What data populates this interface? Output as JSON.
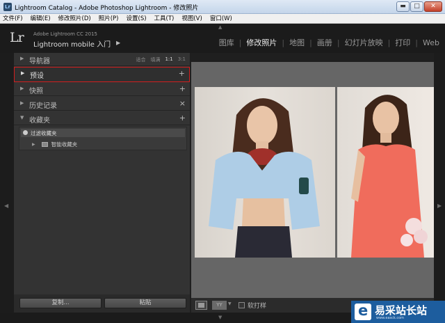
{
  "window": {
    "title": "Lightroom Catalog - Adobe Photoshop Lightroom - 修改照片",
    "minimize": "▬",
    "maximize": "□",
    "close": "✕"
  },
  "menu": [
    "文件(F)",
    "编辑(E)",
    "修改照片(D)",
    "照片(P)",
    "设置(S)",
    "工具(T)",
    "视图(V)",
    "窗口(W)"
  ],
  "identity": {
    "logo": "Lr",
    "line1": "Adobe Lightroom CC 2015",
    "line2": "Lightroom mobile 入门",
    "arrow": "▶"
  },
  "modules": {
    "items": [
      "图库",
      "修改照片",
      "地图",
      "画册",
      "幻灯片放映",
      "打印",
      "Web"
    ],
    "active": "修改照片",
    "separator": "|"
  },
  "left_panel": {
    "navigator": {
      "label": "导航器",
      "options": [
        "适合",
        "填满",
        "1:1",
        "3:1"
      ],
      "selected": "1:1"
    },
    "presets": {
      "label": "预设",
      "action": "+"
    },
    "snapshots": {
      "label": "快照",
      "action": "+"
    },
    "history": {
      "label": "历史记录",
      "action": "×"
    },
    "collections": {
      "label": "收藏夹",
      "action": "+",
      "filter": "过滤收藏夹",
      "smart": "智能收藏夹"
    }
  },
  "footer": {
    "copy": "复制...",
    "paste": "粘贴"
  },
  "toolbar": {
    "view_mode": "YY",
    "soft_proof": "软打样"
  },
  "watermark": {
    "brand": "易采站长站",
    "url": "www.easck.com"
  },
  "colors": {
    "highlight": "#d21f1f",
    "canvas": "#666666",
    "panel": "#333333",
    "watermark": "#1d5d9e"
  }
}
